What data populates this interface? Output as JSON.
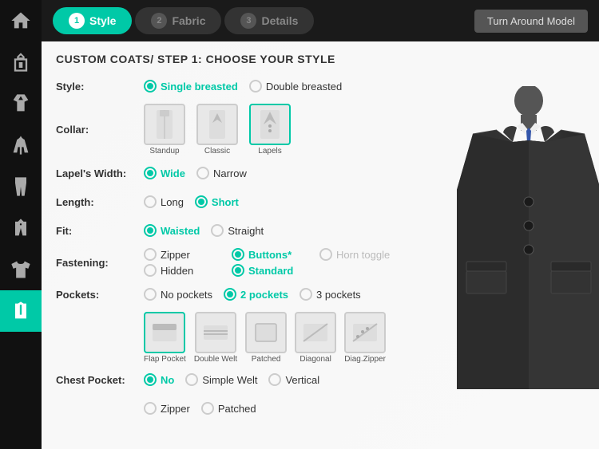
{
  "sidebar": {
    "items": [
      {
        "id": "home",
        "icon": "home",
        "active": false
      },
      {
        "id": "suit",
        "icon": "suit",
        "active": false
      },
      {
        "id": "shirt",
        "icon": "shirt",
        "active": false
      },
      {
        "id": "jacket",
        "icon": "jacket",
        "active": false
      },
      {
        "id": "pants",
        "icon": "pants",
        "active": false
      },
      {
        "id": "vest",
        "icon": "vest",
        "active": false
      },
      {
        "id": "tshirt",
        "icon": "tshirt",
        "active": false
      },
      {
        "id": "overcoat",
        "icon": "overcoat",
        "active": true
      }
    ]
  },
  "topbar": {
    "steps": [
      {
        "num": "1",
        "label": "Style",
        "active": true
      },
      {
        "num": "2",
        "label": "Fabric",
        "active": false
      },
      {
        "num": "3",
        "label": "Details",
        "active": false
      }
    ],
    "turn_around_label": "Turn Around Model"
  },
  "form": {
    "title": "CUSTOM COATS/ STEP 1: CHOOSE YOUR STYLE",
    "style": {
      "label": "Style:",
      "options": [
        {
          "id": "single",
          "label": "Single breasted",
          "selected": true
        },
        {
          "id": "double",
          "label": "Double breasted",
          "selected": false
        }
      ]
    },
    "collar": {
      "label": "Collar:",
      "options": [
        {
          "id": "standup",
          "label": "Standup",
          "selected": false
        },
        {
          "id": "classic",
          "label": "Classic",
          "selected": false
        },
        {
          "id": "lapels",
          "label": "Lapels",
          "selected": true
        }
      ]
    },
    "lapels_width": {
      "label": "Lapel's Width:",
      "options": [
        {
          "id": "wide",
          "label": "Wide",
          "selected": true
        },
        {
          "id": "narrow",
          "label": "Narrow",
          "selected": false
        }
      ]
    },
    "length": {
      "label": "Length:",
      "options": [
        {
          "id": "long",
          "label": "Long",
          "selected": false
        },
        {
          "id": "short",
          "label": "Short",
          "selected": true
        }
      ]
    },
    "fit": {
      "label": "Fit:",
      "options": [
        {
          "id": "waisted",
          "label": "Waisted",
          "selected": true
        },
        {
          "id": "straight",
          "label": "Straight",
          "selected": false
        }
      ]
    },
    "fastening": {
      "label": "Fastening:",
      "options": [
        {
          "id": "zipper",
          "label": "Zipper",
          "selected": false,
          "disabled": false
        },
        {
          "id": "buttons",
          "label": "Buttons*",
          "selected": true,
          "disabled": false
        },
        {
          "id": "horn_toggle",
          "label": "Horn toggle",
          "selected": false,
          "disabled": true
        },
        {
          "id": "hidden",
          "label": "Hidden",
          "selected": false,
          "disabled": false
        },
        {
          "id": "standard",
          "label": "Standard",
          "selected": true,
          "disabled": false
        }
      ]
    },
    "pockets": {
      "label": "Pockets:",
      "count_options": [
        {
          "id": "no_pockets",
          "label": "No pockets",
          "selected": false
        },
        {
          "id": "2_pockets",
          "label": "2 pockets",
          "selected": true
        },
        {
          "id": "3_pockets",
          "label": "3 pockets",
          "selected": false
        }
      ],
      "type_options": [
        {
          "id": "flap",
          "label": "Flap Pocket",
          "selected": true
        },
        {
          "id": "double_welt",
          "label": "Double Welt",
          "selected": false
        },
        {
          "id": "patched",
          "label": "Patched",
          "selected": false
        },
        {
          "id": "diagonal",
          "label": "Diagonal",
          "selected": false
        },
        {
          "id": "diag_zipper",
          "label": "Diag.Zipper",
          "selected": false
        }
      ]
    },
    "chest_pocket": {
      "label": "Chest Pocket:",
      "options": [
        {
          "id": "no",
          "label": "No",
          "selected": true
        },
        {
          "id": "simple_welt",
          "label": "Simple Welt",
          "selected": false
        },
        {
          "id": "vertical",
          "label": "Vertical",
          "selected": false
        },
        {
          "id": "zipper",
          "label": "Zipper",
          "selected": false
        },
        {
          "id": "patched",
          "label": "Patched",
          "selected": false
        }
      ]
    }
  }
}
